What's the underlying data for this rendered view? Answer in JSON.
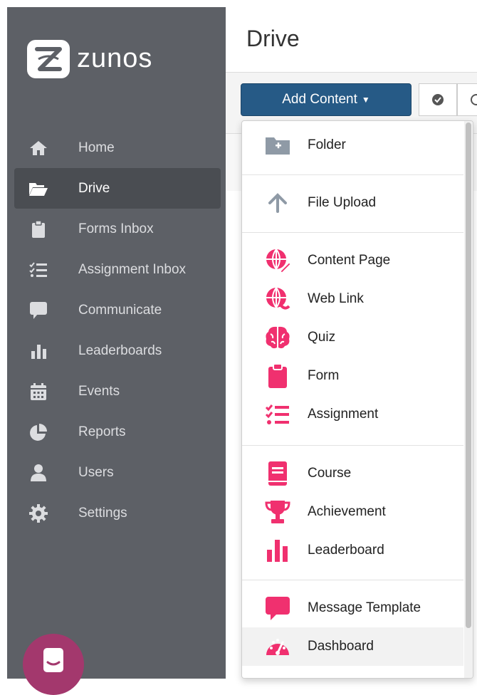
{
  "brand": {
    "name": "zunos"
  },
  "sidebar": {
    "items": [
      {
        "label": "Home",
        "icon": "home-icon"
      },
      {
        "label": "Drive",
        "icon": "folder-open-icon",
        "active": true
      },
      {
        "label": "Forms Inbox",
        "icon": "clipboard-icon"
      },
      {
        "label": "Assignment Inbox",
        "icon": "checklist-icon"
      },
      {
        "label": "Communicate",
        "icon": "speech-bubble-icon"
      },
      {
        "label": "Leaderboards",
        "icon": "bar-chart-icon"
      },
      {
        "label": "Events",
        "icon": "calendar-icon"
      },
      {
        "label": "Reports",
        "icon": "pie-chart-icon"
      },
      {
        "label": "Users",
        "icon": "user-icon"
      },
      {
        "label": "Settings",
        "icon": "gear-icon"
      }
    ]
  },
  "page": {
    "title": "Drive"
  },
  "toolbar": {
    "add_content_label": "Add Content"
  },
  "menu": {
    "items": [
      {
        "label": "Folder",
        "icon": "folder-plus-icon"
      },
      {
        "label": "File Upload",
        "icon": "arrow-up-icon"
      },
      {
        "label": "Content Page",
        "icon": "globe-pencil-icon"
      },
      {
        "label": "Web Link",
        "icon": "globe-link-icon"
      },
      {
        "label": "Quiz",
        "icon": "brain-icon"
      },
      {
        "label": "Form",
        "icon": "clipboard-icon"
      },
      {
        "label": "Assignment",
        "icon": "checklist-icon"
      },
      {
        "label": "Course",
        "icon": "book-icon"
      },
      {
        "label": "Achievement",
        "icon": "trophy-icon"
      },
      {
        "label": "Leaderboard",
        "icon": "bar-chart-icon"
      },
      {
        "label": "Message Template",
        "icon": "speech-bubble-icon"
      },
      {
        "label": "Dashboard",
        "icon": "speedometer-icon"
      }
    ]
  },
  "colors": {
    "sidebar": "#5d6066",
    "accent_pink": "#f0306f",
    "button_blue": "#265a86"
  }
}
